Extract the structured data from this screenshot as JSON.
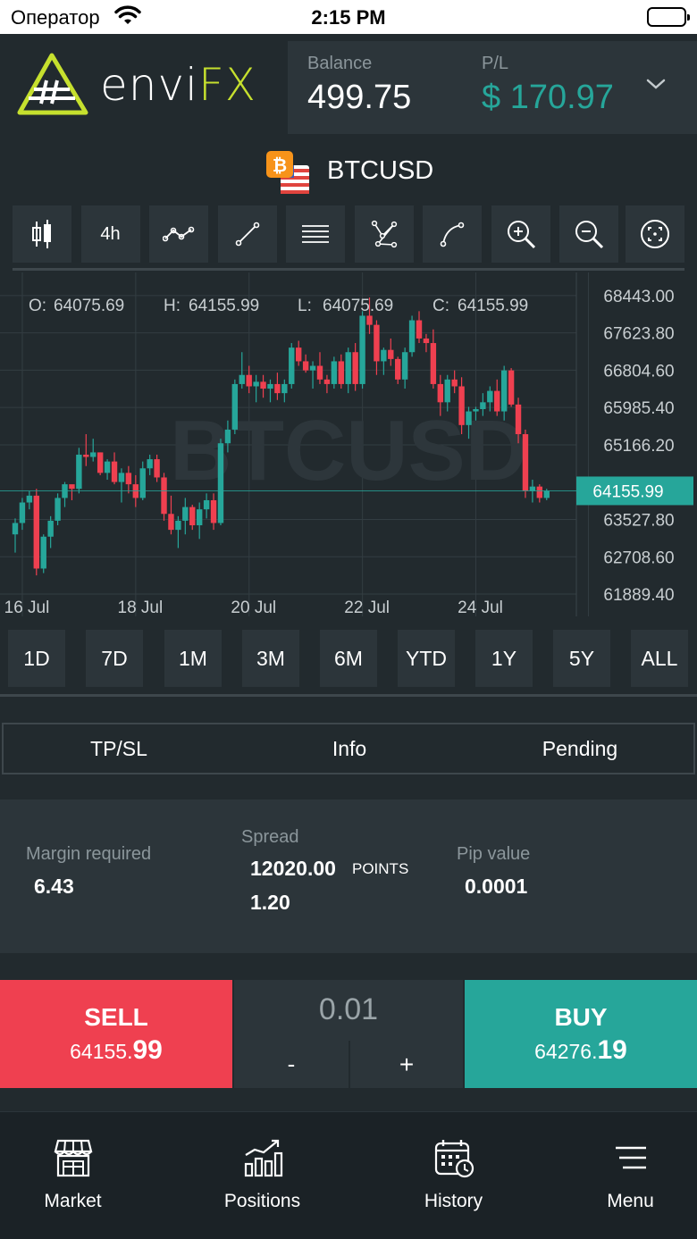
{
  "status": {
    "carrier": "Оператор",
    "time": "2:15 PM"
  },
  "header": {
    "brand_left": "envi",
    "brand_right": "FX",
    "balance_label": "Balance",
    "balance_value": "499.75",
    "pl_label": "P/L",
    "pl_value": "$ 170.97",
    "accent": "#c6e02e"
  },
  "symbol": {
    "name": "BTCUSD",
    "icon": "bitcoin-us-flag-icon"
  },
  "toolbar": {
    "items": [
      {
        "icon": "candlestick-icon"
      },
      {
        "label": "4h"
      },
      {
        "icon": "line-series-icon"
      },
      {
        "icon": "trend-line-icon"
      },
      {
        "icon": "horizontal-lines-icon"
      },
      {
        "icon": "pattern-icon"
      },
      {
        "icon": "curve-icon"
      },
      {
        "icon": "zoom-in-icon"
      },
      {
        "icon": "zoom-out-icon"
      },
      {
        "icon": "fit-screen-icon"
      }
    ]
  },
  "chart_data": {
    "type": "candlestick",
    "watermark": "BTCUSD",
    "ohlc_labels": {
      "o_label": "O:",
      "o": "64075.69",
      "h_label": "H:",
      "h": "64155.99",
      "l_label": "L:",
      "l": "64075.69",
      "c_label": "C:",
      "c": "64155.99"
    },
    "y_ticks": [
      "68443.00",
      "67623.80",
      "66804.60",
      "65985.40",
      "65166.20",
      "63527.80",
      "62708.60",
      "61889.40"
    ],
    "y_tick_values": [
      68443.0,
      67623.8,
      66804.6,
      65985.4,
      65166.2,
      63527.8,
      62708.6,
      61889.4
    ],
    "ylim": [
      61400,
      68950
    ],
    "x_ticks": [
      "16 Jul",
      "18 Jul",
      "20 Jul",
      "22 Jul",
      "24 Jul"
    ],
    "x_tick_index": [
      0,
      16,
      32,
      48,
      64
    ],
    "current_price": "64155.99",
    "current_price_value": 64155.99,
    "up_color": "#26a69a",
    "down_color": "#ef4050",
    "candles": [
      [
        63200,
        63550,
        62800,
        63450
      ],
      [
        63450,
        64000,
        63300,
        63900
      ],
      [
        63900,
        64150,
        63750,
        64050
      ],
      [
        64050,
        64200,
        62300,
        62450
      ],
      [
        62450,
        63200,
        62350,
        63150
      ],
      [
        63150,
        63600,
        62900,
        63500
      ],
      [
        63500,
        64100,
        63400,
        64000
      ],
      [
        64000,
        64350,
        63800,
        64300
      ],
      [
        64300,
        64200,
        63950,
        64200
      ],
      [
        64200,
        65100,
        64100,
        64950
      ],
      [
        64950,
        65400,
        64700,
        64900
      ],
      [
        64900,
        65300,
        64800,
        65000
      ],
      [
        65000,
        65000,
        64500,
        64550
      ],
      [
        64550,
        64850,
        64400,
        64800
      ],
      [
        64800,
        65000,
        64300,
        64350
      ],
      [
        64350,
        64650,
        63900,
        64550
      ],
      [
        64550,
        64700,
        64100,
        64300
      ],
      [
        64300,
        64500,
        63800,
        64000
      ],
      [
        64000,
        64800,
        63950,
        64650
      ],
      [
        64650,
        64950,
        64500,
        64850
      ],
      [
        64850,
        64950,
        64350,
        64450
      ],
      [
        64450,
        64550,
        63500,
        63650
      ],
      [
        63650,
        64050,
        63200,
        63300
      ],
      [
        63300,
        63600,
        62900,
        63500
      ],
      [
        63500,
        64000,
        63200,
        63800
      ],
      [
        63800,
        63850,
        63300,
        63400
      ],
      [
        63400,
        63900,
        63100,
        63750
      ],
      [
        63750,
        64100,
        63550,
        63950
      ],
      [
        63950,
        64100,
        63300,
        63450
      ],
      [
        63450,
        65300,
        63400,
        65200
      ],
      [
        65200,
        65700,
        65000,
        65500
      ],
      [
        65500,
        66600,
        65400,
        66500
      ],
      [
        66500,
        67200,
        66400,
        66700
      ],
      [
        66700,
        66900,
        66300,
        66450
      ],
      [
        66450,
        66700,
        66100,
        66550
      ],
      [
        66550,
        66700,
        66200,
        66400
      ],
      [
        66400,
        66600,
        66100,
        66500
      ],
      [
        66500,
        66750,
        66150,
        66300
      ],
      [
        66300,
        66600,
        66100,
        66500
      ],
      [
        66500,
        67400,
        66400,
        67300
      ],
      [
        67300,
        67450,
        66900,
        67000
      ],
      [
        67000,
        67150,
        66750,
        66800
      ],
      [
        66800,
        67000,
        66400,
        66900
      ],
      [
        66900,
        67200,
        66500,
        66600
      ],
      [
        66600,
        66700,
        66300,
        66500
      ],
      [
        66500,
        67100,
        66400,
        67000
      ],
      [
        67000,
        67150,
        66400,
        66500
      ],
      [
        66500,
        67300,
        66300,
        67200
      ],
      [
        67200,
        67400,
        66350,
        66500
      ],
      [
        66500,
        68100,
        66400,
        68000
      ],
      [
        68000,
        68400,
        67600,
        67800
      ],
      [
        67800,
        67900,
        66700,
        67000
      ],
      [
        67000,
        67300,
        66700,
        67250
      ],
      [
        67250,
        67500,
        66900,
        67050
      ],
      [
        67050,
        67100,
        66500,
        66600
      ],
      [
        66600,
        67300,
        66400,
        67200
      ],
      [
        67200,
        68000,
        67100,
        67900
      ],
      [
        67900,
        68100,
        67400,
        67500
      ],
      [
        67500,
        67600,
        67200,
        67400
      ],
      [
        67400,
        67700,
        66400,
        66500
      ],
      [
        66500,
        66700,
        65800,
        66100
      ],
      [
        66100,
        66700,
        65900,
        66600
      ],
      [
        66600,
        66800,
        66300,
        66450
      ],
      [
        66450,
        66650,
        65400,
        65600
      ],
      [
        65600,
        66000,
        65300,
        65900
      ],
      [
        65900,
        66000,
        65700,
        65950
      ],
      [
        65950,
        66300,
        65800,
        66100
      ],
      [
        66100,
        66450,
        65900,
        66350
      ],
      [
        66350,
        66600,
        65800,
        65900
      ],
      [
        65900,
        66900,
        65700,
        66800
      ],
      [
        66800,
        66850,
        66000,
        66050
      ],
      [
        66050,
        66200,
        65200,
        65400
      ],
      [
        65400,
        65500,
        64000,
        64150
      ],
      [
        64150,
        64400,
        63900,
        64250
      ],
      [
        64250,
        64300,
        63900,
        64000
      ],
      [
        64000,
        64200,
        63950,
        64155.99
      ]
    ]
  },
  "periods": [
    "1D",
    "7D",
    "1M",
    "3M",
    "6M",
    "YTD",
    "1Y",
    "5Y",
    "ALL"
  ],
  "tabs": [
    "TP/SL",
    "Info",
    "Pending"
  ],
  "info": {
    "margin_label": "Margin required",
    "margin_value": "6.43",
    "spread_label": "Spread",
    "spread_value": "12020.00",
    "spread_unit": "POINTS",
    "spread_value2": "1.20",
    "pip_label": "Pip value",
    "pip_value": "0.0001"
  },
  "trade": {
    "sell_label": "SELL",
    "sell_price_main": "64155.",
    "sell_price_big": "99",
    "buy_label": "BUY",
    "buy_price_main": "64276.",
    "buy_price_big": "19",
    "quantity": "0.01",
    "minus": "-",
    "plus": "+",
    "sell_color": "#ef4050",
    "buy_color": "#26a69a"
  },
  "nav": [
    {
      "label": "Market",
      "icon": "market-store-icon"
    },
    {
      "label": "Positions",
      "icon": "positions-chart-icon"
    },
    {
      "label": "History",
      "icon": "history-calendar-icon"
    },
    {
      "label": "Menu",
      "icon": "menu-icon"
    }
  ]
}
